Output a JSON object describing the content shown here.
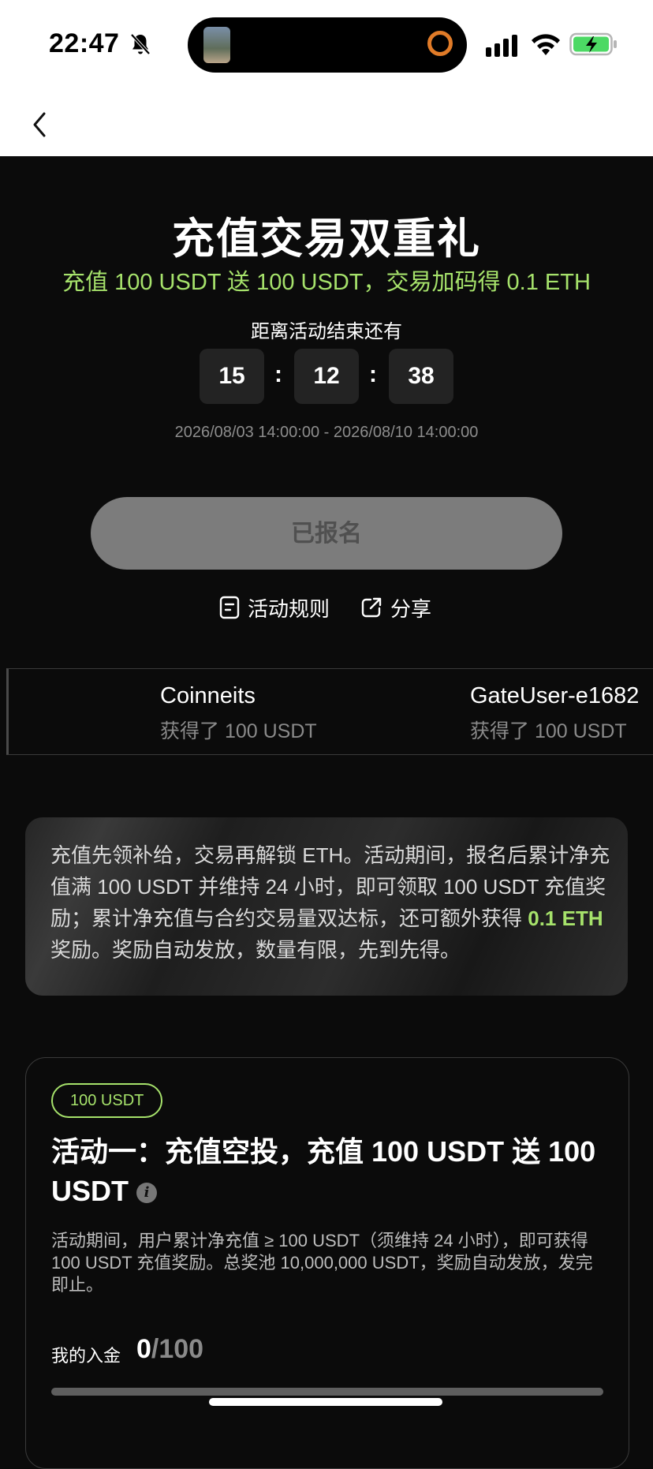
{
  "status_bar": {
    "time": "22:47"
  },
  "hero": {
    "title": "充值交易双重礼",
    "subtitle": "充值 100 USDT 送 100 USDT，交易加码得 0.1 ETH",
    "countdown_label": "距离活动结束还有",
    "countdown": {
      "hours": "15",
      "minutes": "12",
      "seconds": "38",
      "separator": ":"
    },
    "date_range": "2026/08/03 14:00:00 - 2026/08/10 14:00:00",
    "register_label": "已报名"
  },
  "links": {
    "rules": "活动规则",
    "share": "分享"
  },
  "ticker": [
    {
      "name": "Coinneits",
      "amount": "获得了 100 USDT"
    },
    {
      "name": "GateUser-e1682",
      "amount": "获得了 100 USDT"
    }
  ],
  "promo": {
    "text_before": "充值先领补给，交易再解锁 ETH。活动期间，报名后累计净充值满 100 USDT 并维持 24 小时，即可领取 100 USDT 充值奖励；累计净充值与合约交易量双达标，还可额外获得 ",
    "highlight": "0.1 ETH",
    "text_after": " 奖励。奖励自动发放，数量有限，先到先得。"
  },
  "card": {
    "badge": "100 USDT",
    "title": "活动一：充值空投，充值 100 USDT 送 100 USDT",
    "info_glyph": "i",
    "description": "活动期间，用户累计净充值 ≥ 100 USDT（须维持 24 小时），即可获得 100 USDT 充值奖励。总奖池 10,000,000 USDT，奖励自动发放，发完即止。",
    "deposit_label": "我的入金",
    "deposit_current": "0",
    "deposit_total": "/100",
    "progress": 0
  },
  "colors": {
    "accent": "#a6e26b",
    "background": "#0b0b0b",
    "button_disabled": "#7c7c7c"
  },
  "icons": [
    "bell-slash-icon",
    "signal-icon",
    "wifi-icon",
    "battery-charging-icon",
    "back-chevron-icon",
    "document-icon",
    "share-icon",
    "info-icon"
  ]
}
